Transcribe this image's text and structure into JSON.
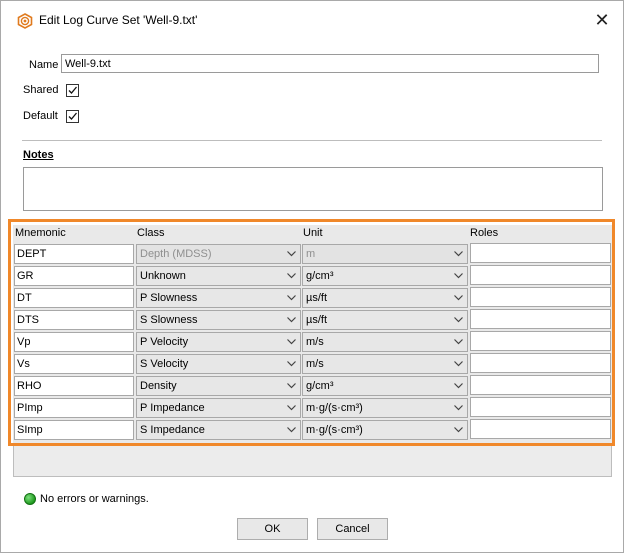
{
  "window": {
    "title": "Edit Log Curve Set 'Well-9.txt'",
    "close_glyph": "✕"
  },
  "form": {
    "name_label": "Name",
    "name_value": "Well-9.txt",
    "shared_label": "Shared",
    "shared_checked": true,
    "default_label": "Default",
    "default_checked": true,
    "notes_label": "Notes",
    "notes_value": ""
  },
  "table": {
    "headers": {
      "mnemonic": "Mnemonic",
      "class": "Class",
      "unit": "Unit",
      "roles": "Roles"
    },
    "rows": [
      {
        "mnemonic": "DEPT",
        "class": "Depth (MDSS)",
        "unit": "m",
        "roles": "",
        "disabled": true
      },
      {
        "mnemonic": "GR",
        "class": "Unknown",
        "unit": "g/cm³",
        "roles": "",
        "disabled": false
      },
      {
        "mnemonic": "DT",
        "class": "P Slowness",
        "unit": "µs/ft",
        "roles": "",
        "disabled": false
      },
      {
        "mnemonic": "DTS",
        "class": "S Slowness",
        "unit": "µs/ft",
        "roles": "",
        "disabled": false
      },
      {
        "mnemonic": "Vp",
        "class": "P Velocity",
        "unit": "m/s",
        "roles": "",
        "disabled": false
      },
      {
        "mnemonic": "Vs",
        "class": "S Velocity",
        "unit": "m/s",
        "roles": "",
        "disabled": false
      },
      {
        "mnemonic": "RHO",
        "class": "Density",
        "unit": "g/cm³",
        "roles": "",
        "disabled": false
      },
      {
        "mnemonic": "PImp",
        "class": "P Impedance",
        "unit": "m·g/(s·cm³)",
        "roles": "",
        "disabled": false
      },
      {
        "mnemonic": "SImp",
        "class": "S Impedance",
        "unit": "m·g/(s·cm³)",
        "roles": "",
        "disabled": false
      }
    ]
  },
  "status": {
    "icon": "green-status-dot-icon",
    "text": "No errors or warnings.",
    "color": "#1f9a1f"
  },
  "buttons": {
    "ok": "OK",
    "cancel": "Cancel"
  },
  "colors": {
    "highlight": "#f0882a"
  }
}
